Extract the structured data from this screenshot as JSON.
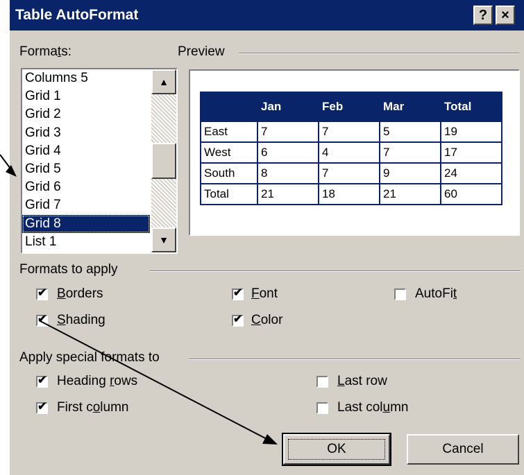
{
  "window": {
    "title": "Table AutoFormat",
    "help_label": "?",
    "close_label": "×"
  },
  "formats": {
    "label_pre": "Forma",
    "label_mnemonic": "t",
    "label_post": "s:",
    "items": [
      "Columns 5",
      "Grid 1",
      "Grid 2",
      "Grid 3",
      "Grid 4",
      "Grid 5",
      "Grid 6",
      "Grid 7",
      "Grid 8",
      "List 1"
    ],
    "selected": "Grid 8"
  },
  "preview": {
    "label": "Preview",
    "columns": [
      "",
      "Jan",
      "Feb",
      "Mar",
      "Total"
    ],
    "rows": [
      [
        "East",
        "7",
        "7",
        "5",
        "19"
      ],
      [
        "West",
        "6",
        "4",
        "7",
        "17"
      ],
      [
        "South",
        "8",
        "7",
        "9",
        "24"
      ],
      [
        "Total",
        "21",
        "18",
        "21",
        "60"
      ]
    ]
  },
  "formats_to_apply": {
    "label": "Formats to apply",
    "borders": {
      "mnemonic": "B",
      "rest": "orders",
      "checked": true
    },
    "font": {
      "mnemonic": "F",
      "rest": "ont",
      "checked": true
    },
    "autofit_pre": "AutoFi",
    "autofit_mnemonic": "t",
    "autofit_checked": false,
    "shading": {
      "mnemonic": "S",
      "rest": "hading",
      "checked": true
    },
    "color": {
      "mnemonic": "C",
      "rest": "olor",
      "checked": true
    }
  },
  "special_formats": {
    "label": "Apply special formats to",
    "heading_rows": {
      "pre": "Heading ",
      "mnemonic": "r",
      "post": "ows",
      "checked": true
    },
    "first_column": {
      "pre": "First c",
      "mnemonic": "o",
      "post": "lumn",
      "checked": true
    },
    "last_row": {
      "pre": "",
      "mnemonic": "L",
      "post": "ast row",
      "checked": false
    },
    "last_column": {
      "pre": "Last col",
      "mnemonic": "u",
      "post": "mn",
      "checked": false
    }
  },
  "buttons": {
    "ok": "OK",
    "cancel": "Cancel"
  },
  "check_glyph": "✔",
  "colors": {
    "titlebar": "#0a246a",
    "dialog_bg": "#d4d0c8",
    "selection": "#0a246a"
  }
}
